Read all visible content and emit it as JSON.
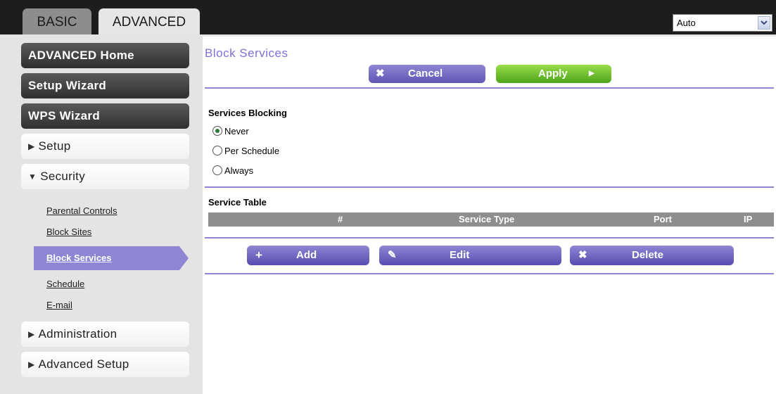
{
  "top_tabs": {
    "basic": "BASIC",
    "advanced": "ADVANCED"
  },
  "language_select": {
    "value": "Auto"
  },
  "sidebar": {
    "advanced_home": "ADVANCED Home",
    "setup_wizard": "Setup Wizard",
    "wps_wizard": "WPS Wizard",
    "setup": "Setup",
    "security": "Security",
    "security_items": [
      "Parental Controls",
      "Block Sites",
      "Block Services",
      "Schedule",
      "E-mail"
    ],
    "administration": "Administration",
    "advanced_setup": "Advanced Setup"
  },
  "main": {
    "title": "Block Services",
    "cancel_label": "Cancel",
    "apply_label": "Apply",
    "services_blocking_title": "Services Blocking",
    "blocking_options": [
      {
        "label": "Never",
        "selected": true
      },
      {
        "label": "Per Schedule",
        "selected": false
      },
      {
        "label": "Always",
        "selected": false
      }
    ],
    "service_table_title": "Service Table",
    "table_columns": [
      "#",
      "Service Type",
      "Port",
      "IP"
    ],
    "add_label": "Add",
    "edit_label": "Edit",
    "delete_label": "Delete"
  },
  "colors": {
    "accent_purple": "#8f86d3",
    "apply_green": "#6cbf2a",
    "topbar": "#1d1d1d",
    "sidebar_bg": "#e4e4e4"
  }
}
